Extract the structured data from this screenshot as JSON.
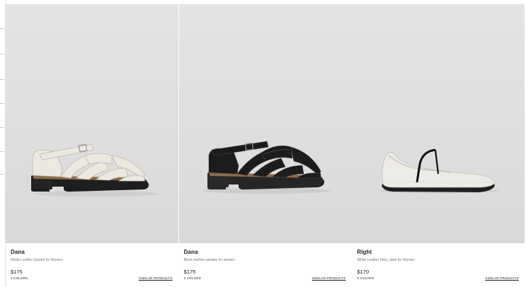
{
  "products": [
    {
      "name": "Dana",
      "description": "White Leather Sandal for Women",
      "price": "$175",
      "colors": "3 COLORS",
      "similar_label": "SIMILAR PRODUCTS",
      "shoe_color": "#ece9e2"
    },
    {
      "name": "Dana",
      "description": "Black leather sandals for women",
      "price": "$175",
      "colors": "3 COLORS",
      "similar_label": "SIMILAR PRODUCTS",
      "shoe_color": "#1c1c1c"
    },
    {
      "name": "Right",
      "description": "White Leather Mary Jane for Women",
      "price": "$170",
      "colors": "5 COLORS",
      "similar_label": "SIMILAR PRODUCTS",
      "shoe_color": "#ecebe6"
    }
  ]
}
